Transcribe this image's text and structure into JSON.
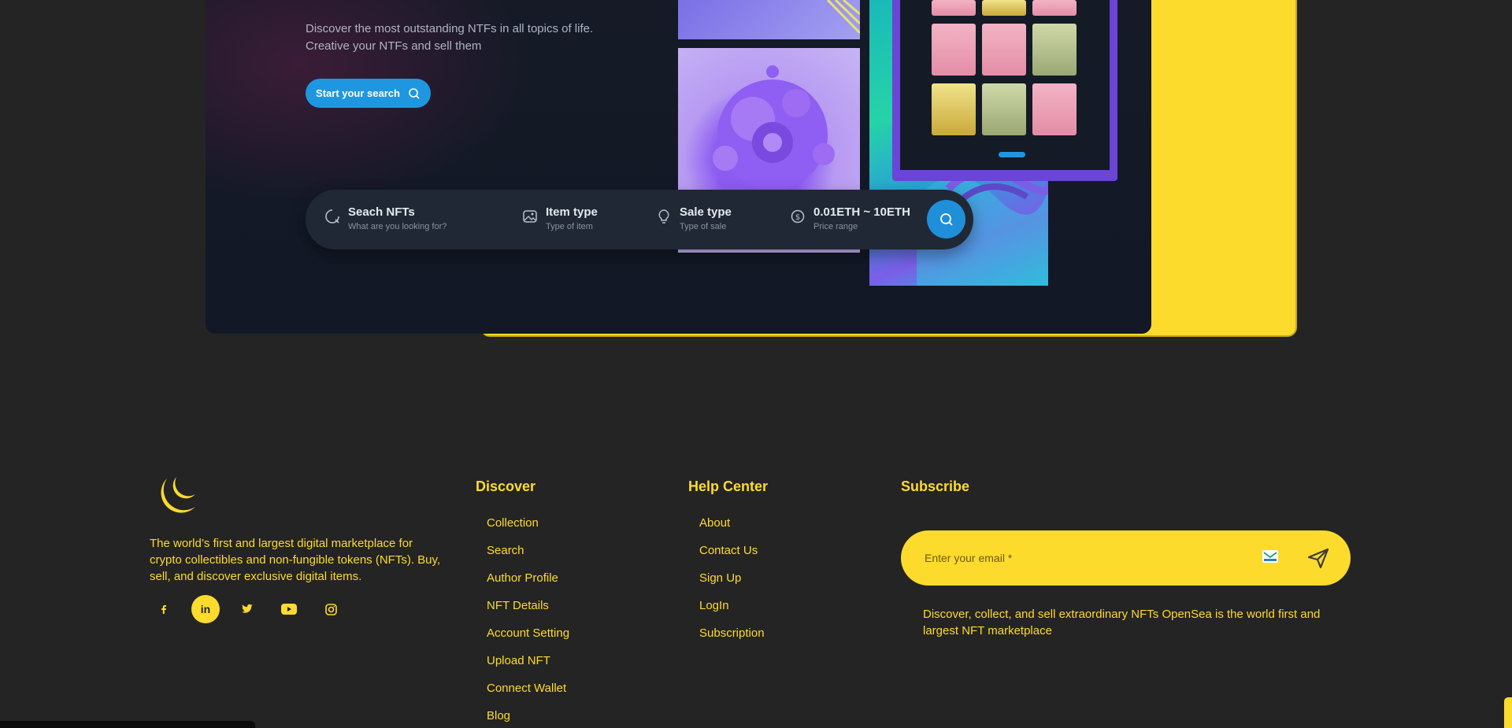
{
  "hero": {
    "description_line1": "Discover the most outstanding NTFs in all topics of life.",
    "description_line2": "Creative your NTFs and sell them",
    "start_button": "Start your search"
  },
  "search_bar": {
    "items": [
      {
        "title": "Seach NFTs",
        "sub": "What are you looking for?",
        "icon": "search-loading-icon"
      },
      {
        "title": "Item type",
        "sub": "Type of item",
        "icon": "image-icon"
      },
      {
        "title": "Sale type",
        "sub": "Type of sale",
        "icon": "lightbulb-icon"
      },
      {
        "title": "0.01ETH ~ 10ETH",
        "sub": "Price range",
        "icon": "dollar-icon"
      }
    ]
  },
  "footer": {
    "about": "The world’s first and largest digital marketplace for crypto collectibles and non-fungible tokens (NFTs). Buy, sell, and discover exclusive digital items.",
    "socials": [
      {
        "label": "f",
        "icon": "facebook-icon"
      },
      {
        "label": "in",
        "icon": "linkedin-icon"
      },
      {
        "label": "twitter",
        "icon": "twitter-icon"
      },
      {
        "label": "youtube",
        "icon": "youtube-icon"
      },
      {
        "label": "instagram",
        "icon": "instagram-icon"
      }
    ],
    "discover": {
      "heading": "Discover",
      "links": [
        "Collection",
        "Search",
        "Author Profile",
        "NFT Details",
        "Account Setting",
        "Upload NFT",
        "Connect Wallet",
        "Blog"
      ]
    },
    "help": {
      "heading": "Help Center",
      "links": [
        "About",
        "Contact Us",
        "Sign Up",
        "LogIn",
        "Subscription"
      ]
    },
    "subscribe": {
      "heading": "Subscribe",
      "placeholder": "Enter your email *",
      "text": "Discover, collect, and sell extraordinary NFTs OpenSea is the world first and largest NFT marketplace"
    }
  },
  "colors": {
    "accent": "#fddb2d",
    "background": "#242424",
    "hero_bg": "#121826",
    "primary_blue": "#1f97e0"
  }
}
